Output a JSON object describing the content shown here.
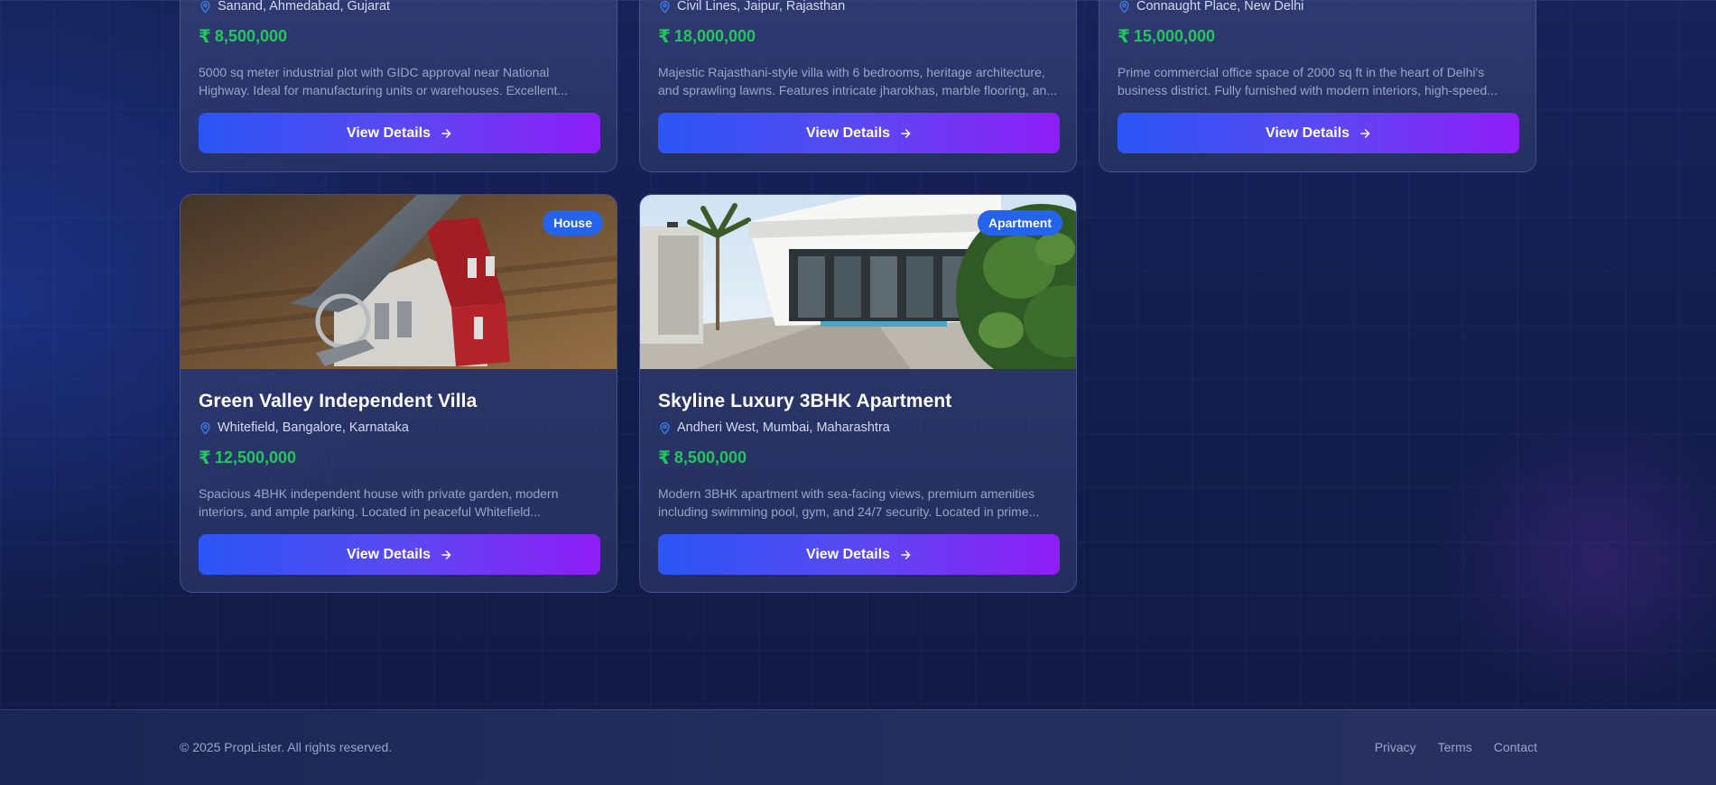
{
  "top_cards": [
    {
      "location": "Sanand, Ahmedabad, Gujarat",
      "currency": "₹",
      "price": "8,500,000",
      "description": [
        "5000 sq meter industrial plot with GIDC approval near National",
        "Highway. Ideal for manufacturing units or warehouses. Excellent..."
      ],
      "button": "View Details"
    },
    {
      "location": "Civil Lines, Jaipur, Rajasthan",
      "currency": "₹",
      "price": "18,000,000",
      "description": [
        "Majestic Rajasthani-style villa with 6 bedrooms, heritage architecture,",
        "and sprawling lawns. Features intricate jharokhas, marble flooring, an..."
      ],
      "button": "View Details"
    },
    {
      "location": "Connaught Place, New Delhi",
      "currency": "₹",
      "price": "15,000,000",
      "description": [
        "Prime commercial office space of 2000 sq ft in the heart of Delhi's",
        "business district. Fully furnished with modern interiors, high-speed..."
      ],
      "button": "View Details"
    }
  ],
  "bottom_cards": [
    {
      "badge": "House",
      "title": "Green Valley Independent Villa",
      "location": "Whitefield, Bangalore, Karnataka",
      "currency": "₹",
      "price": "12,500,000",
      "description": [
        "Spacious 4BHK independent house with private garden, modern",
        "interiors, and ample parking. Located in peaceful Whitefield..."
      ],
      "button": "View Details"
    },
    {
      "badge": "Apartment",
      "title": "Skyline Luxury 3BHK Apartment",
      "location": "Andheri West, Mumbai, Maharashtra",
      "currency": "₹",
      "price": "8,500,000",
      "description": [
        "Modern 3BHK apartment with sea-facing views, premium amenities",
        "including swimming pool, gym, and 24/7 security. Located in prime..."
      ],
      "button": "View Details"
    }
  ],
  "footer": {
    "copyright": "© 2025 PropLister. All rights reserved.",
    "links": [
      "Privacy",
      "Terms",
      "Contact"
    ]
  },
  "colors": {
    "price": "#22c55e",
    "badge": "#2563eb",
    "button_start": "#2b55f5",
    "button_end": "#8f1df6",
    "background": "#141e4e"
  },
  "icons": {
    "location": "map-pin-icon",
    "button_arrow": "arrow-right-icon"
  }
}
